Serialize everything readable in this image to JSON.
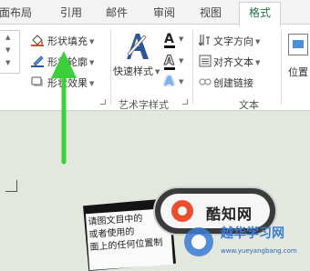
{
  "tabs": [
    "面布局",
    "引用",
    "邮件",
    "审阅",
    "视图",
    "格式"
  ],
  "ribbon": {
    "shape_fill": "形状填充",
    "shape_outline": "形状轮廓",
    "shape_effects": "形状效果",
    "quick_styles": "快速样式",
    "wordart_group": "艺术字样式",
    "text_direction": "文字方向",
    "align_text": "对齐文本",
    "create_link": "创建链接",
    "text_group": "文本",
    "position": "位置"
  },
  "document": {
    "lines": [
      "请图文目中的",
      "或者使用的",
      "面上的任何位置制"
    ]
  },
  "watermark": {
    "badge_text": "酷知网",
    "site_title": "越华学习网",
    "url": "www.yueyangbang.com"
  },
  "colors": {
    "arrow": "#3ccf3c",
    "accent": "#217346",
    "wordart_a": "#2b579a"
  }
}
